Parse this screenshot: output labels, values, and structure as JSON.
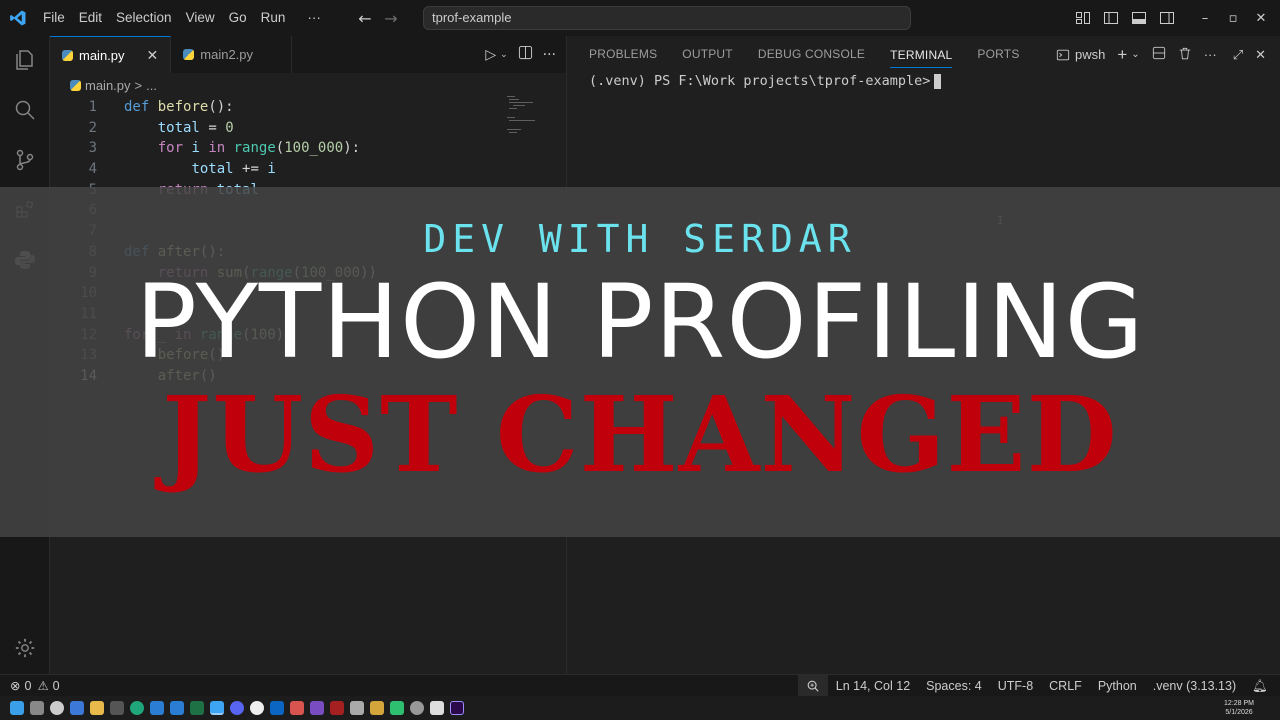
{
  "menu": {
    "items": [
      "File",
      "Edit",
      "Selection",
      "View",
      "Go",
      "Run"
    ],
    "more": "···"
  },
  "command_center": {
    "text": "tprof-example"
  },
  "editor": {
    "tabs": [
      {
        "label": "main.py",
        "active": true
      },
      {
        "label": "main2.py",
        "active": false
      }
    ],
    "breadcrumb": {
      "file": "main.py",
      "separator": ">",
      "rest": "..."
    },
    "current_line": 14,
    "line_numbers": [
      "1",
      "2",
      "3",
      "4",
      "5",
      "6",
      "7",
      "8",
      "9",
      "10",
      "11",
      "12",
      "13",
      "14"
    ]
  },
  "panel": {
    "tabs": [
      "PROBLEMS",
      "OUTPUT",
      "DEBUG CONSOLE",
      "TERMINAL",
      "PORTS"
    ],
    "active_tab": "TERMINAL",
    "terminal_profile": "pwsh",
    "prompt": "(.venv) PS F:\\Work projects\\tprof-example>"
  },
  "overlay": {
    "brand": "DEV WITH SERDAR",
    "title": "PYTHON PROFILING",
    "subtitle": "JUST CHANGED",
    "brand_color": "#6be3ef",
    "subtitle_color": "#c0000a"
  },
  "statusbar": {
    "errors": "0",
    "warnings": "0",
    "position": "Ln 14, Col 12",
    "spaces": "Spaces: 4",
    "encoding": "UTF-8",
    "eol": "CRLF",
    "language": "Python",
    "interpreter": ".venv (3.13.13)"
  },
  "taskbar": {
    "time": "12:28 PM",
    "date": "5/1/2026"
  },
  "colors": {
    "accent": "#0078d4",
    "keyword": "#569cd6",
    "function": "#dcdcaa"
  }
}
